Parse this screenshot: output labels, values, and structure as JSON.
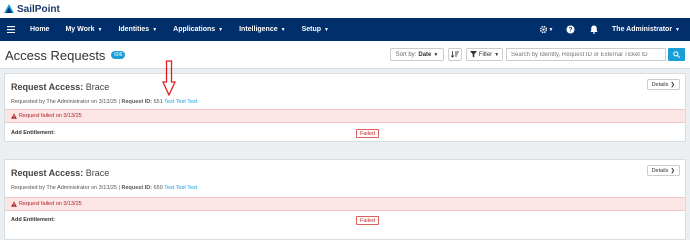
{
  "brand": {
    "name": "SailPoint",
    "logo_icon": "sailpoint-logo-icon"
  },
  "nav": {
    "menu_icon": "hamburger-icon",
    "items": [
      {
        "label": "Home",
        "has_caret": false
      },
      {
        "label": "My Work",
        "has_caret": true
      },
      {
        "label": "Identities",
        "has_caret": true
      },
      {
        "label": "Applications",
        "has_caret": true
      },
      {
        "label": "Intelligence",
        "has_caret": true
      },
      {
        "label": "Setup",
        "has_caret": true
      }
    ],
    "icons": [
      "gear-icon",
      "help-icon",
      "bell-icon"
    ],
    "user": "The Administrator"
  },
  "page": {
    "title": "Access Requests",
    "count": "606",
    "sort_label": "Sort by:",
    "sort_value": "Date",
    "filter_label": "Filter",
    "search_placeholder": "Search by Identity, Request ID or External Ticket ID"
  },
  "cards": [
    {
      "title_prefix": "Request Access:",
      "identity": "Brace",
      "requested_by": "Requested by The Administrator on 3/13/25",
      "request_id_label": "Request ID:",
      "request_id": "651",
      "ticket": "Test Test Test",
      "details_label": "Details",
      "alert_text": "Request failed on 3/13/25",
      "entitlement_label": "Add Entitlement:",
      "status": "Failed"
    },
    {
      "title_prefix": "Request Access:",
      "identity": "Brace",
      "requested_by": "Requested by The Administrator on 3/13/25",
      "request_id_label": "Request ID:",
      "request_id": "650",
      "ticket": "Test Test Test",
      "details_label": "Details",
      "alert_text": "Request failed on 3/13/25",
      "entitlement_label": "Add Entitlement:",
      "status": "Failed"
    }
  ],
  "colors": {
    "nav_bg": "#002f6c",
    "accent": "#1a9ed8",
    "alert_bg": "#fbe5e5",
    "error": "#c62828",
    "annotation_arrow": "#e02020"
  }
}
